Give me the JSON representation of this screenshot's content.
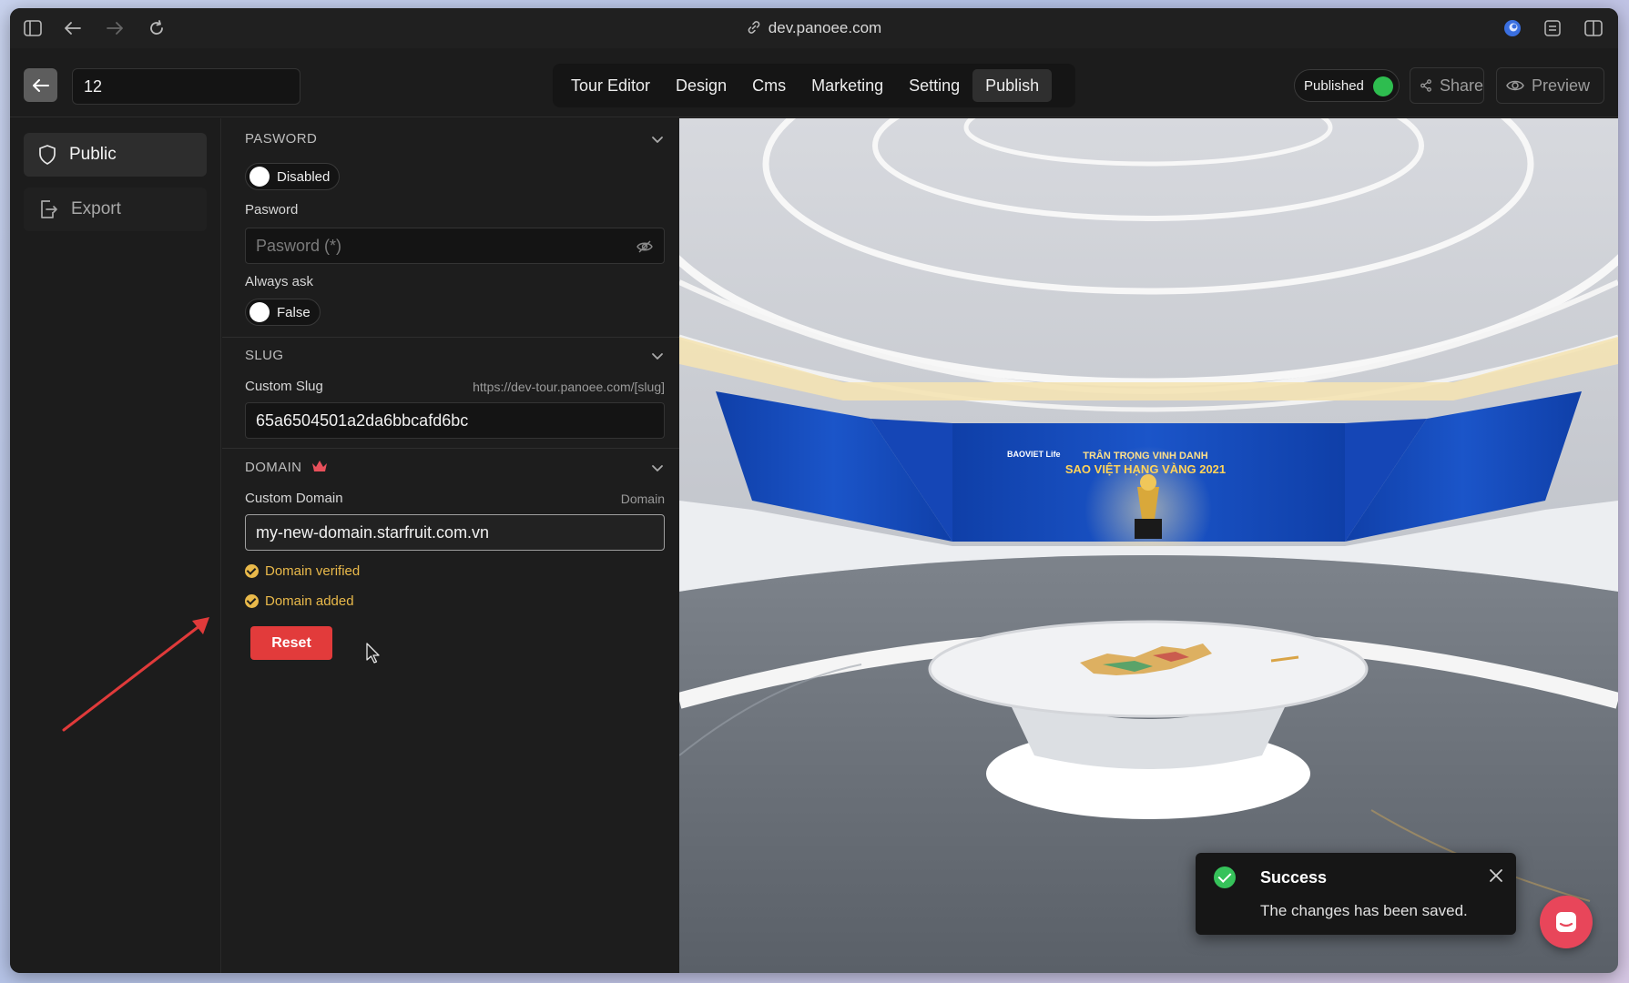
{
  "browser": {
    "url": "dev.panoee.com"
  },
  "header": {
    "tour_name": "12",
    "tabs": [
      {
        "label": "Tour Editor",
        "active": false
      },
      {
        "label": "Design",
        "active": false
      },
      {
        "label": "Cms",
        "active": false
      },
      {
        "label": "Marketing",
        "active": false
      },
      {
        "label": "Setting",
        "active": false
      },
      {
        "label": "Publish",
        "active": true
      }
    ],
    "published_label": "Published",
    "published_color": "#2ebd4f",
    "share_label": "Share",
    "preview_label": "Preview"
  },
  "sidebar": {
    "items": [
      {
        "label": "Public",
        "icon": "shield-icon",
        "active": true
      },
      {
        "label": "Export",
        "icon": "export-icon",
        "active": false
      }
    ]
  },
  "password_section": {
    "title": "PASWORD",
    "toggle_label": "Disabled",
    "password_label": "Pasword",
    "password_placeholder": "Pasword (*)",
    "always_ask_label": "Always ask",
    "always_ask_value": "False"
  },
  "slug_section": {
    "title": "SLUG",
    "custom_slug_label": "Custom Slug",
    "slug_hint": "https://dev-tour.panoee.com/[slug]",
    "slug_value": "65a6504501a2da6bbcafd6bc"
  },
  "domain_section": {
    "title": "DOMAIN",
    "custom_domain_label": "Custom Domain",
    "domain_hint": "Domain",
    "domain_value": "my-new-domain.starfruit.com.vn",
    "status_verified": "Domain verified",
    "status_added": "Domain added",
    "status_color": "#e9b94a",
    "reset_label": "Reset",
    "reset_color": "#e23b3b"
  },
  "scene": {
    "banner_line1": "TRÂN TRỌNG VINH DANH",
    "banner_line2": "SAO VIỆT HẠNG VÀNG 2021",
    "banner_logo": "BAOVIET Life"
  },
  "toast": {
    "title": "Success",
    "message": "The changes has been saved.",
    "color": "#36c25a"
  },
  "accent_colors": {
    "annotation_arrow": "#e03a3a",
    "chat_bubble": "#e8465a"
  }
}
